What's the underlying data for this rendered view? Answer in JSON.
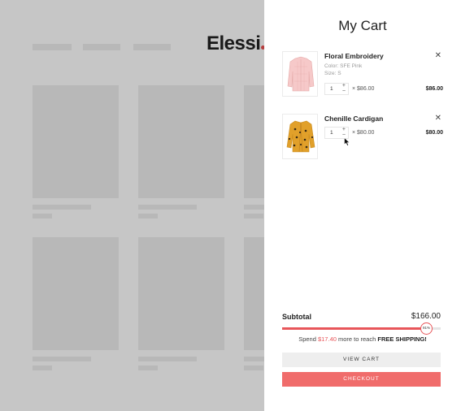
{
  "store": {
    "logo_text": "Elessi"
  },
  "cart": {
    "title": "My Cart",
    "items": [
      {
        "name": "Floral Embroidery",
        "color_label": "Color: SFE Pink",
        "size_label": "Size: S",
        "quantity": "1",
        "unit_price_text": "× $86.00",
        "line_total": "$86.00",
        "thumbnail": "pink-jacket-image",
        "thumbnail_color": "#f6c9c9"
      },
      {
        "name": "Chenille Cardigan",
        "quantity": "1",
        "unit_price_text": "× $80.00",
        "line_total": "$80.00",
        "thumbnail": "mustard-cardigan-image",
        "thumbnail_color": "#e1a02a"
      }
    ],
    "subtotal_label": "Subtotal",
    "subtotal_value": "$166.00",
    "shipping_progress_percent": 91,
    "shipping_progress_label": "91%",
    "shipping_message": {
      "prefix": "Spend ",
      "amount": "$17.40",
      "middle": " more to reach ",
      "highlight": "FREE SHIPPING!"
    },
    "view_cart_label": "VIEW CART",
    "checkout_label": "CHECKOUT",
    "colors": {
      "accent": "#f06c6b",
      "progress": "#e8565a"
    }
  }
}
